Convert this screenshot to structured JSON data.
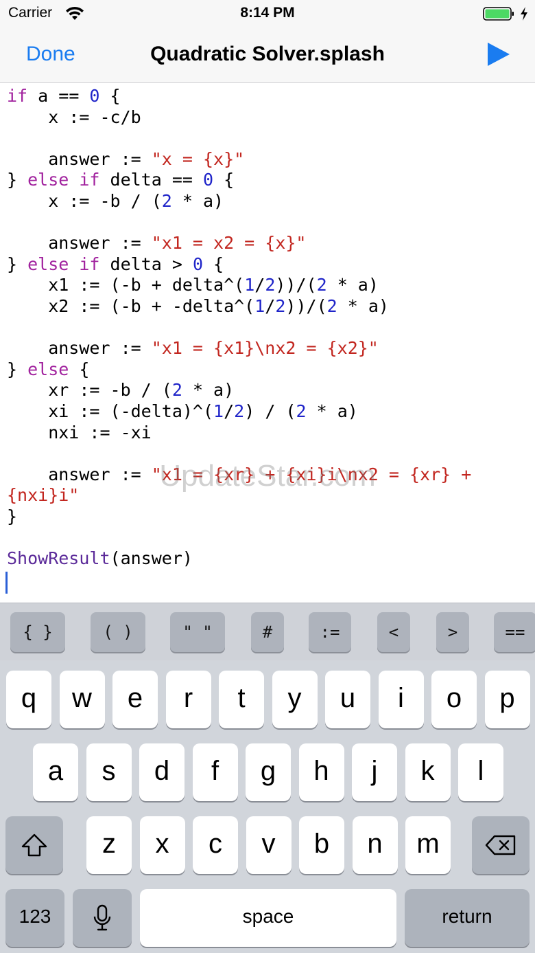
{
  "status_bar": {
    "carrier": "Carrier",
    "time": "8:14 PM"
  },
  "nav": {
    "done_label": "Done",
    "title": "Quadratic Solver.splash",
    "run_icon": "play-icon"
  },
  "editor": {
    "lines": [
      [
        {
          "t": "kw",
          "v": "if"
        },
        {
          "t": "plain",
          "v": " a == "
        },
        {
          "t": "num",
          "v": "0"
        },
        {
          "t": "plain",
          "v": " {"
        }
      ],
      [
        {
          "t": "plain",
          "v": "    x := -c/b"
        }
      ],
      [
        {
          "t": "plain",
          "v": ""
        }
      ],
      [
        {
          "t": "plain",
          "v": "    answer := "
        },
        {
          "t": "str",
          "v": "\"x = {x}\""
        }
      ],
      [
        {
          "t": "plain",
          "v": "} "
        },
        {
          "t": "kw",
          "v": "else if"
        },
        {
          "t": "plain",
          "v": " delta == "
        },
        {
          "t": "num",
          "v": "0"
        },
        {
          "t": "plain",
          "v": " {"
        }
      ],
      [
        {
          "t": "plain",
          "v": "    x := -b / ("
        },
        {
          "t": "num",
          "v": "2"
        },
        {
          "t": "plain",
          "v": " * a)"
        }
      ],
      [
        {
          "t": "plain",
          "v": ""
        }
      ],
      [
        {
          "t": "plain",
          "v": "    answer := "
        },
        {
          "t": "str",
          "v": "\"x1 = x2 = {x}\""
        }
      ],
      [
        {
          "t": "plain",
          "v": "} "
        },
        {
          "t": "kw",
          "v": "else if"
        },
        {
          "t": "plain",
          "v": " delta > "
        },
        {
          "t": "num",
          "v": "0"
        },
        {
          "t": "plain",
          "v": " {"
        }
      ],
      [
        {
          "t": "plain",
          "v": "    x1 := (-b + delta^("
        },
        {
          "t": "num",
          "v": "1"
        },
        {
          "t": "plain",
          "v": "/"
        },
        {
          "t": "num",
          "v": "2"
        },
        {
          "t": "plain",
          "v": "))/("
        },
        {
          "t": "num",
          "v": "2"
        },
        {
          "t": "plain",
          "v": " * a)"
        }
      ],
      [
        {
          "t": "plain",
          "v": "    x2 := (-b + -delta^("
        },
        {
          "t": "num",
          "v": "1"
        },
        {
          "t": "plain",
          "v": "/"
        },
        {
          "t": "num",
          "v": "2"
        },
        {
          "t": "plain",
          "v": "))/("
        },
        {
          "t": "num",
          "v": "2"
        },
        {
          "t": "plain",
          "v": " * a)"
        }
      ],
      [
        {
          "t": "plain",
          "v": ""
        }
      ],
      [
        {
          "t": "plain",
          "v": "    answer := "
        },
        {
          "t": "str",
          "v": "\"x1 = {x1}\\nx2 = {x2}\""
        }
      ],
      [
        {
          "t": "plain",
          "v": "} "
        },
        {
          "t": "kw",
          "v": "else"
        },
        {
          "t": "plain",
          "v": " {"
        }
      ],
      [
        {
          "t": "plain",
          "v": "    xr := -b / ("
        },
        {
          "t": "num",
          "v": "2"
        },
        {
          "t": "plain",
          "v": " * a)"
        }
      ],
      [
        {
          "t": "plain",
          "v": "    xi := (-delta)^("
        },
        {
          "t": "num",
          "v": "1"
        },
        {
          "t": "plain",
          "v": "/"
        },
        {
          "t": "num",
          "v": "2"
        },
        {
          "t": "plain",
          "v": ") / ("
        },
        {
          "t": "num",
          "v": "2"
        },
        {
          "t": "plain",
          "v": " * a)"
        }
      ],
      [
        {
          "t": "plain",
          "v": "    nxi := -xi"
        }
      ],
      [
        {
          "t": "plain",
          "v": ""
        }
      ],
      [
        {
          "t": "plain",
          "v": "    answer := "
        },
        {
          "t": "str",
          "v": "\"x1 = {xr} + {xi}i\\nx2 = {xr} +"
        }
      ],
      [
        {
          "t": "str",
          "v": "{nxi}i\""
        }
      ],
      [
        {
          "t": "plain",
          "v": "}"
        }
      ],
      [
        {
          "t": "plain",
          "v": ""
        }
      ],
      [
        {
          "t": "fn",
          "v": "ShowResult"
        },
        {
          "t": "plain",
          "v": "(answer)"
        }
      ]
    ],
    "watermark": "UpdateStar.com"
  },
  "accessory_keys": [
    {
      "label": "{ }",
      "name": "braces"
    },
    {
      "label": "( )",
      "name": "parens"
    },
    {
      "label": "\" \"",
      "name": "quotes"
    },
    {
      "label": "#",
      "name": "hash"
    },
    {
      "label": ":=",
      "name": "assign"
    },
    {
      "label": "<",
      "name": "less-than"
    },
    {
      "label": ">",
      "name": "greater-than"
    },
    {
      "label": "==",
      "name": "equals"
    }
  ],
  "keyboard": {
    "row1": [
      "q",
      "w",
      "e",
      "r",
      "t",
      "y",
      "u",
      "i",
      "o",
      "p"
    ],
    "row2": [
      "a",
      "s",
      "d",
      "f",
      "g",
      "h",
      "j",
      "k",
      "l"
    ],
    "row3": [
      "z",
      "x",
      "c",
      "v",
      "b",
      "n",
      "m"
    ],
    "numbers_label": "123",
    "space_label": "space",
    "return_label": "return",
    "shift_icon": "shift-icon",
    "delete_icon": "delete-icon",
    "mic_icon": "microphone-icon"
  },
  "colors": {
    "accent": "#1a7cf0",
    "keyword": "#a1229e",
    "number": "#1f24c9",
    "string": "#c2261f",
    "function": "#5b2a99"
  }
}
